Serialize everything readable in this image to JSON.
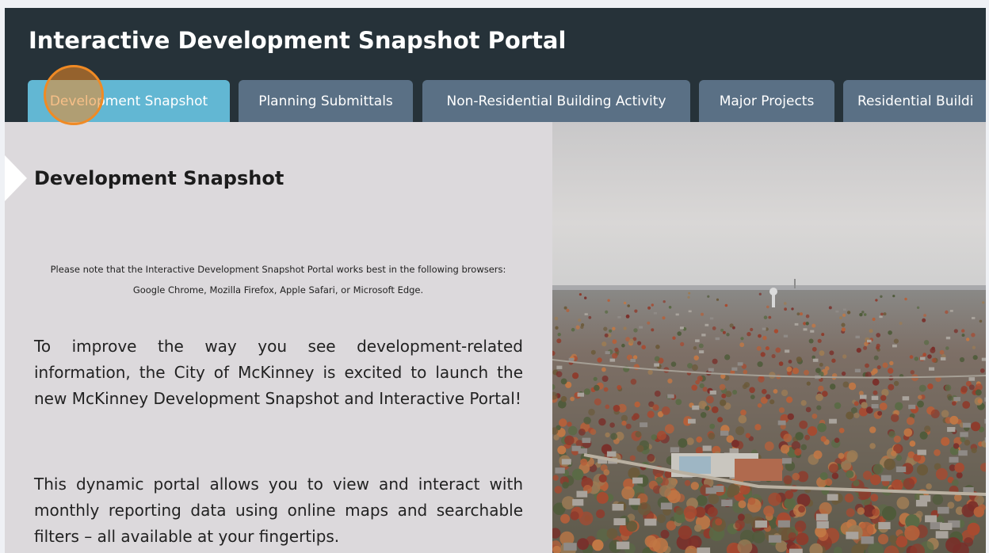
{
  "app": {
    "title": "Interactive Development Snapshot Portal"
  },
  "tabs": [
    {
      "label": "Development Snapshot",
      "active": true
    },
    {
      "label": "Planning Submittals",
      "active": false
    },
    {
      "label": "Non-Residential Building Activity",
      "active": false
    },
    {
      "label": "Major Projects",
      "active": false
    },
    {
      "label": "Residential Buildi",
      "active": false
    }
  ],
  "content": {
    "title": "Development Snapshot",
    "browser_note": "Please note that the Interactive Development Snapshot Portal works best in the following browsers: Google Chrome, Mozilla Firefox, Apple Safari, or Microsoft Edge.",
    "paragraph_1": "To improve the way you see development-related information, the City of McKinney is excited to launch the new McKinney Development Snapshot and Interactive Portal!",
    "paragraph_2": "This dynamic portal allows you to view and interact with monthly reporting data using online maps and searchable filters – all available at your fingertips."
  },
  "colors": {
    "header_bg": "#263239",
    "tab_bg": "#5a7085",
    "tab_active_bg": "#62b7d3",
    "panel_bg": "#dcd9dc",
    "click_indicator": "#f08a24"
  },
  "image": {
    "subject": "aerial-photo-city-autumn"
  }
}
